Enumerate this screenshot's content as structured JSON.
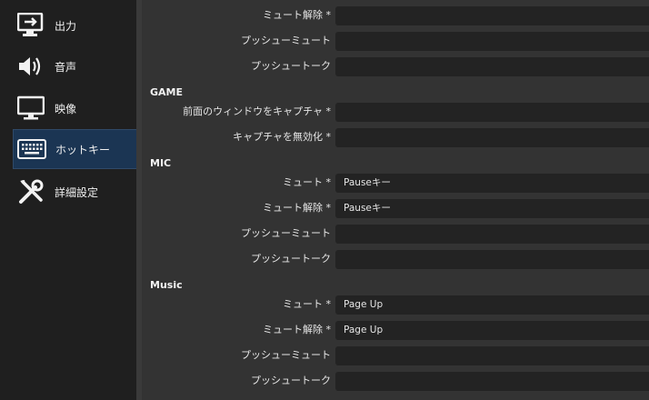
{
  "sidebar": {
    "items": [
      {
        "label": "出力",
        "icon": "output-icon"
      },
      {
        "label": "音声",
        "icon": "speaker-icon"
      },
      {
        "label": "映像",
        "icon": "monitor-icon"
      },
      {
        "label": "ホットキー",
        "icon": "keyboard-icon",
        "active": true
      },
      {
        "label": "詳細設定",
        "icon": "wrench-screwdriver-icon"
      }
    ]
  },
  "hotkeys": {
    "top_rows": [
      {
        "label": "ミュート解除 *",
        "value": ""
      },
      {
        "label": "プッシューミュート",
        "value": ""
      },
      {
        "label": "プッシュートーク",
        "value": ""
      }
    ],
    "groups": [
      {
        "title": "GAME",
        "rows": [
          {
            "label": "前面のウィンドウをキャプチャ *",
            "value": ""
          },
          {
            "label": "キャプチャを無効化 *",
            "value": ""
          }
        ]
      },
      {
        "title": "MIC",
        "rows": [
          {
            "label": "ミュート *",
            "value": "Pauseキー"
          },
          {
            "label": "ミュート解除 *",
            "value": "Pauseキー"
          },
          {
            "label": "プッシューミュート",
            "value": ""
          },
          {
            "label": "プッシュートーク",
            "value": ""
          }
        ]
      },
      {
        "title": "Music",
        "rows": [
          {
            "label": "ミュート *",
            "value": "Page Up"
          },
          {
            "label": "ミュート解除 *",
            "value": "Page Up"
          },
          {
            "label": "プッシューミュート",
            "value": ""
          },
          {
            "label": "プッシュートーク",
            "value": ""
          }
        ]
      }
    ]
  }
}
